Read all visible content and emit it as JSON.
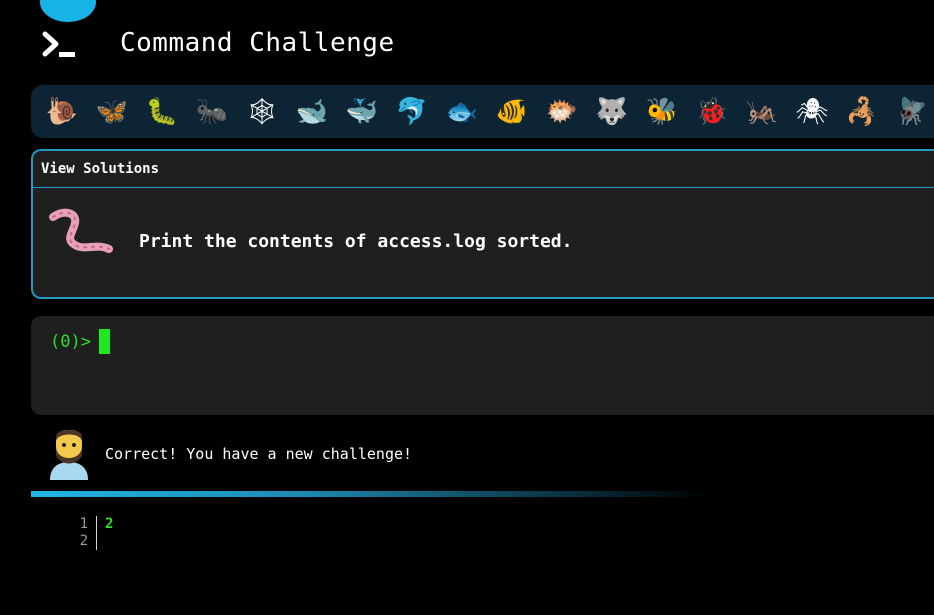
{
  "header": {
    "title": "Command Challenge",
    "logo_icon": "terminal-prompt-icon"
  },
  "emoji_bar": {
    "items": [
      {
        "name": "snail-icon",
        "glyph": "🐌"
      },
      {
        "name": "butterfly-icon",
        "glyph": "🦋"
      },
      {
        "name": "caterpillar-icon",
        "glyph": "🐛"
      },
      {
        "name": "ant-icon",
        "glyph": "🐜"
      },
      {
        "name": "spider-web-icon",
        "glyph": "🕸"
      },
      {
        "name": "whale-icon",
        "glyph": "🐋"
      },
      {
        "name": "spouting-whale-icon",
        "glyph": "🐳"
      },
      {
        "name": "dolphin-icon",
        "glyph": "🐬"
      },
      {
        "name": "fish-icon",
        "glyph": "🐟"
      },
      {
        "name": "tropical-fish-icon",
        "glyph": "🐠"
      },
      {
        "name": "blowfish-icon",
        "glyph": "🐡"
      },
      {
        "name": "wolf-icon",
        "glyph": "🐺"
      },
      {
        "name": "bee-icon",
        "glyph": "🐝"
      },
      {
        "name": "ladybug-icon",
        "glyph": "🐞"
      },
      {
        "name": "cricket-icon",
        "glyph": "🦗"
      },
      {
        "name": "spider-icon",
        "glyph": "🕷"
      },
      {
        "name": "scorpion-icon",
        "glyph": "🦂"
      },
      {
        "name": "fly-icon",
        "glyph": "🪰"
      }
    ]
  },
  "solutions": {
    "header": "View Solutions",
    "challenge_icon": "worm-icon",
    "challenge_text": "Print the contents of access.log sorted."
  },
  "terminal": {
    "prompt": "(0)>"
  },
  "feedback": {
    "avatar_icon": "bearded-man-icon",
    "message": "Correct! You have a new challenge!"
  },
  "output": {
    "lines": [
      {
        "num": "1",
        "text": "2"
      },
      {
        "num": "2",
        "text": ""
      }
    ]
  },
  "colors": {
    "accent": "#2696c4",
    "prompt_green": "#2adf2a",
    "panel_bg": "#1f1f1f"
  }
}
